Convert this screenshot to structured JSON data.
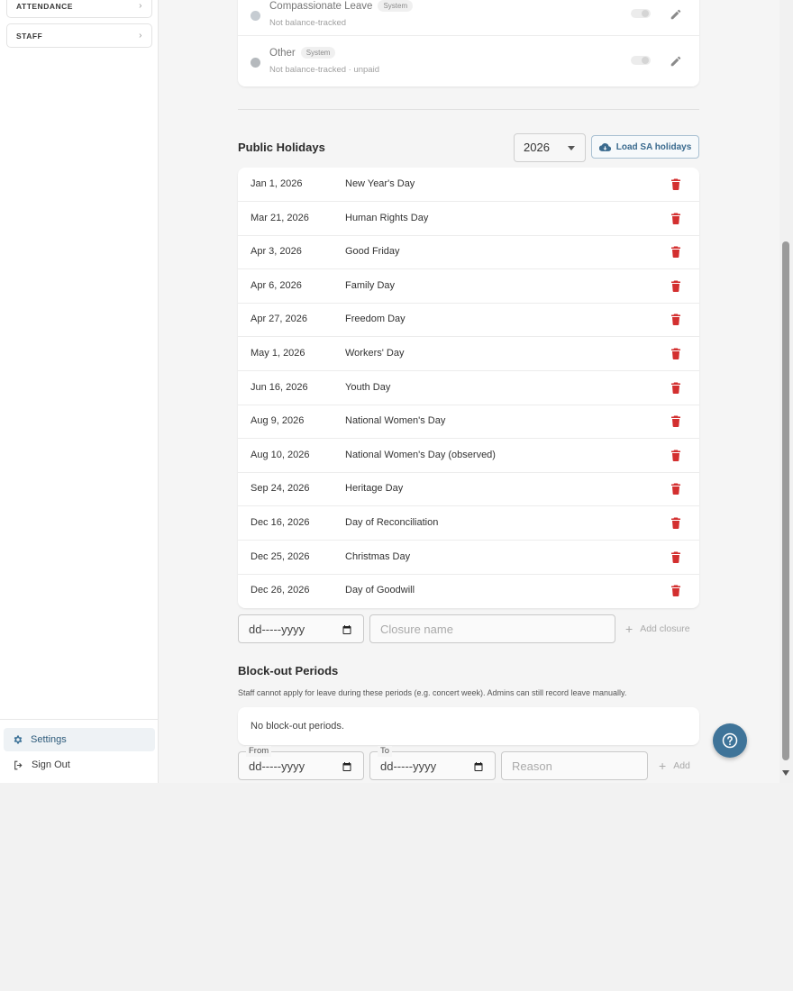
{
  "sidebar": {
    "nav_items": [
      {
        "label": "ATTENDANCE"
      },
      {
        "label": "STAFF"
      }
    ],
    "bottom_links": [
      {
        "label": "Settings",
        "icon": "gear-icon",
        "active": true
      },
      {
        "label": "Sign Out",
        "icon": "sign-out-icon",
        "active": false
      }
    ]
  },
  "leave_types": [
    {
      "name": "Compassionate Leave",
      "badge": "System",
      "sub": "Not balance-tracked"
    },
    {
      "name": "Other",
      "badge": "System",
      "sub": "Not balance-tracked · unpaid"
    }
  ],
  "public_holidays": {
    "title": "Public Holidays",
    "year": "2026",
    "load_button": "Load SA holidays",
    "rows": [
      {
        "date": "Jan 1, 2026",
        "name": "New Year's Day"
      },
      {
        "date": "Mar 21, 2026",
        "name": "Human Rights Day"
      },
      {
        "date": "Apr 3, 2026",
        "name": "Good Friday"
      },
      {
        "date": "Apr 6, 2026",
        "name": "Family Day"
      },
      {
        "date": "Apr 27, 2026",
        "name": "Freedom Day"
      },
      {
        "date": "May 1, 2026",
        "name": "Workers' Day"
      },
      {
        "date": "Jun 16, 2026",
        "name": "Youth Day"
      },
      {
        "date": "Aug 9, 2026",
        "name": "National Women's Day"
      },
      {
        "date": "Aug 10, 2026",
        "name": "National Women's Day (observed)"
      },
      {
        "date": "Sep 24, 2026",
        "name": "Heritage Day"
      },
      {
        "date": "Dec 16, 2026",
        "name": "Day of Reconciliation"
      },
      {
        "date": "Dec 25, 2026",
        "name": "Christmas Day"
      },
      {
        "date": "Dec 26, 2026",
        "name": "Day of Goodwill"
      }
    ],
    "date_value": "dd-----yyyy",
    "closure_placeholder": "Closure name",
    "add_closure_label": "Add closure"
  },
  "blockout": {
    "title": "Block-out Periods",
    "description": "Staff cannot apply for leave during these periods (e.g. concert week). Admins can still record leave manually.",
    "empty_text": "No block-out periods.",
    "from_label": "From",
    "to_label": "To",
    "from_value": "dd-----yyyy",
    "to_value": "dd-----yyyy",
    "reason_placeholder": "Reason",
    "add_label": "Add"
  },
  "colors": {
    "accent": "#3f7499",
    "danger": "#d32f2f",
    "active_bg": "#eef2f5"
  }
}
